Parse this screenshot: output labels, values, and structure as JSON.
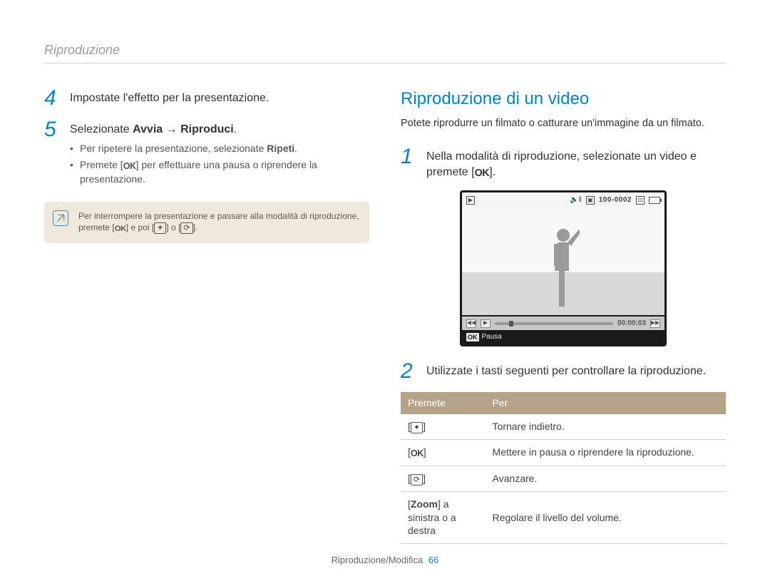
{
  "running_head": "Riproduzione",
  "left": {
    "step4": {
      "num": "4",
      "text": "Impostate l'effetto per la presentazione."
    },
    "step5": {
      "num": "5",
      "text_parts": {
        "a": "Selezionate ",
        "b_bold": "Avvia",
        "c": " → ",
        "d_bold": "Riproduci",
        "e": "."
      },
      "bullet1": {
        "a": "Per ripetere la presentazione, selezionate ",
        "b_bold": "Ripeti",
        "c": "."
      },
      "bullet2": {
        "a": "Premete [",
        "ok": "OK",
        "b": "] per effettuare una pausa o riprendere la presentazione."
      }
    },
    "note": {
      "line1": "Per interrompere la presentazione e passare alla modalità di riproduzione,",
      "line2_a": "premete [",
      "line2_ok": "OK",
      "line2_b": "] e poi [",
      "line2_c": "] o [",
      "line2_d": "]."
    }
  },
  "right": {
    "title": "Riproduzione di un video",
    "subtitle": "Potete riprodurre un filmato o catturare un'immagine da un filmato.",
    "step1": {
      "num": "1",
      "a": "Nella modalità di riproduzione, selezionate un video e premete [",
      "ok": "OK",
      "b": "]."
    },
    "camera": {
      "file_label": "100-0002",
      "time": "00:00:03",
      "pause_label": "Pausa",
      "ok_label": "OK"
    },
    "step2": {
      "num": "2",
      "text": "Utilizzate i tasti seguenti per controllare la riproduzione."
    },
    "table": {
      "head_press": "Premete",
      "head_for": "Per",
      "rows": [
        {
          "press_type": "flash",
          "for": "Tornare indietro."
        },
        {
          "press_type": "ok",
          "for": "Mettere in pausa o riprendere la riproduzione."
        },
        {
          "press_type": "timer",
          "for": "Avanzare."
        },
        {
          "press_type": "zoom",
          "zoom_a": "Zoom",
          "zoom_b": " a sinistra o a destra",
          "for": "Regolare il livello del volume."
        }
      ]
    }
  },
  "footer": {
    "section": "Riproduzione/Modifica",
    "page": "66"
  },
  "icons": {
    "flash_glyph": "✦",
    "timer_glyph": "⟳"
  }
}
